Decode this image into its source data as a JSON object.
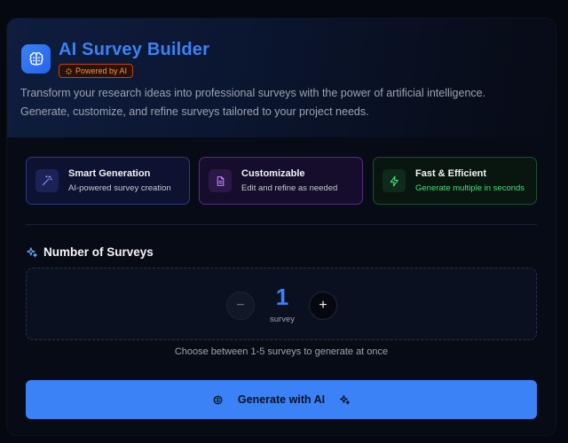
{
  "header": {
    "title": "AI Survey Builder",
    "badge": "Powered by AI",
    "subtitle": "Transform your research ideas into professional surveys with the power of artificial intelligence. Generate, customize, and refine surveys tailored to your project needs.",
    "logo_icon": "brain-icon",
    "accent_color": "#3b82f6",
    "badge_color": "#fb923c"
  },
  "features": [
    {
      "name": "Smart Generation",
      "description": "AI-powered survey creation",
      "icon": "magic-wand-icon",
      "color": "#6366f1"
    },
    {
      "name": "Customizable",
      "description": "Edit and refine as needed",
      "icon": "document-icon",
      "color": "#a855f7"
    },
    {
      "name": "Fast & Efficient",
      "description": "Generate multiple in seconds",
      "icon": "lightning-icon",
      "color": "#22c55e"
    }
  ],
  "survey_count": {
    "title": "Number of Surveys",
    "icon": "sparkles-icon",
    "value": "1",
    "unit": "survey",
    "decrement_label": "−",
    "increment_label": "+",
    "hint": "Choose between 1-5 surveys to generate at once"
  },
  "generate_button": {
    "label": "Generate with AI",
    "left_icon": "brain-icon",
    "right_icon": "sparkles-icon"
  }
}
